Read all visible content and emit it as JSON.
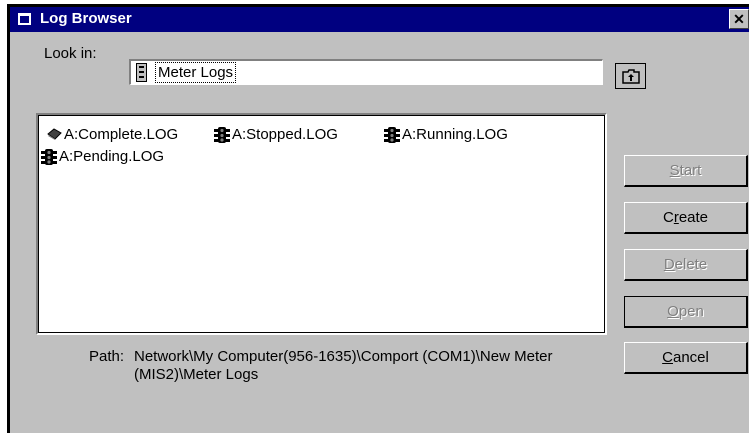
{
  "window": {
    "title": "Log Browser",
    "close_glyph": "✕"
  },
  "lookin": {
    "label": "Look in:",
    "value": "Meter Logs",
    "icon": "meter-icon"
  },
  "up_button": {
    "icon": "up-folder-icon"
  },
  "files": [
    {
      "name": "A:Complete.LOG",
      "icon": "complete-log-icon"
    },
    {
      "name": "A:Stopped.LOG",
      "icon": "stopped-log-icon"
    },
    {
      "name": "A:Running.LOG",
      "icon": "running-log-icon"
    },
    {
      "name": "A:Pending.LOG",
      "icon": "pending-log-icon"
    }
  ],
  "buttons": {
    "start": {
      "prefix": "",
      "accel": "S",
      "rest": "tart",
      "enabled": false
    },
    "create": {
      "prefix": "C",
      "accel": "r",
      "rest": "eate",
      "enabled": true
    },
    "delete": {
      "prefix": "",
      "accel": "D",
      "rest": "elete",
      "enabled": false
    },
    "open": {
      "prefix": "",
      "accel": "O",
      "rest": "pen",
      "enabled": false
    },
    "cancel": {
      "prefix": "",
      "accel": "C",
      "rest": "ancel",
      "enabled": true
    }
  },
  "path": {
    "label": "Path:",
    "value": "Network\\My Computer(956-1635)\\Comport (COM1)\\New Meter (MIS2)\\Meter Logs"
  },
  "colors": {
    "titlebar": "#000080",
    "face": "#c0c0c0",
    "disabled_text": "#808080"
  }
}
